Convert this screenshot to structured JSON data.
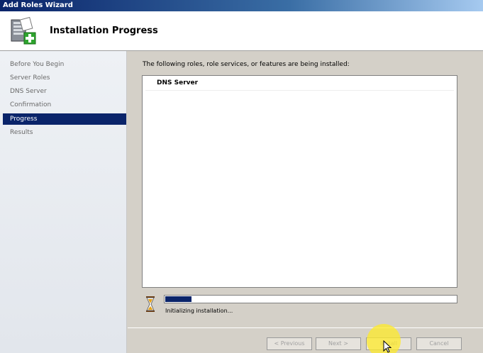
{
  "window": {
    "title": "Add Roles Wizard"
  },
  "header": {
    "title": "Installation Progress",
    "icon": "server-add-icon"
  },
  "nav": {
    "items": [
      {
        "label": "Before You Begin",
        "active": false
      },
      {
        "label": "Server Roles",
        "active": false
      },
      {
        "label": "DNS Server",
        "active": false
      },
      {
        "label": "Confirmation",
        "active": false
      },
      {
        "label": "Progress",
        "active": true
      },
      {
        "label": "Results",
        "active": false
      }
    ]
  },
  "main": {
    "intro": "The following roles, role services, or features are being installed:",
    "items": [
      "DNS Server"
    ]
  },
  "progress": {
    "percent": 9,
    "status": "Initializing installation...",
    "icon": "hourglass-icon"
  },
  "buttons": {
    "previous": "< Previous",
    "next": "Next >",
    "install": "Install",
    "cancel": "Cancel"
  },
  "colors": {
    "accent": "#0a246a",
    "highlight": "#ffeb28"
  }
}
